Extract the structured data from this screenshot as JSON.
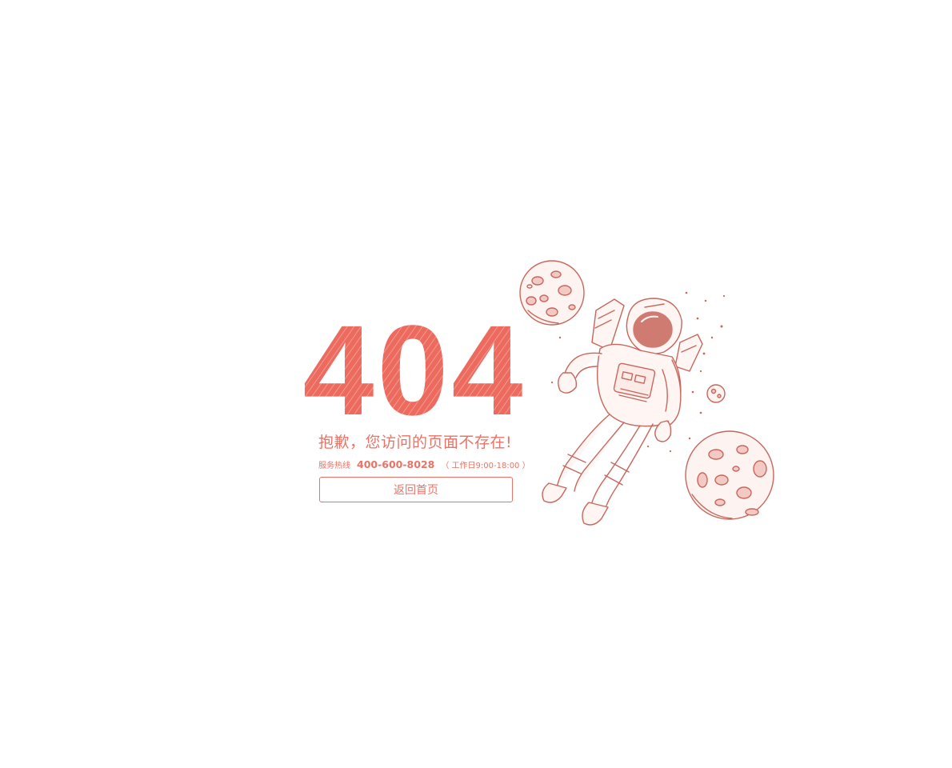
{
  "error": {
    "code": "404",
    "message": "抱歉，您访问的页面不存在!",
    "hotline_label": "服务热线",
    "hotline_number": "400-600-8028",
    "hotline_hours": "（ 工作日9:00-18:00 ）",
    "home_button_label": "返回首页"
  },
  "colors": {
    "accent": "#e87366",
    "line_art": "#c8665c",
    "background": "#ffffff"
  },
  "illustration": {
    "subject": "astronaut-floating-with-moons"
  }
}
